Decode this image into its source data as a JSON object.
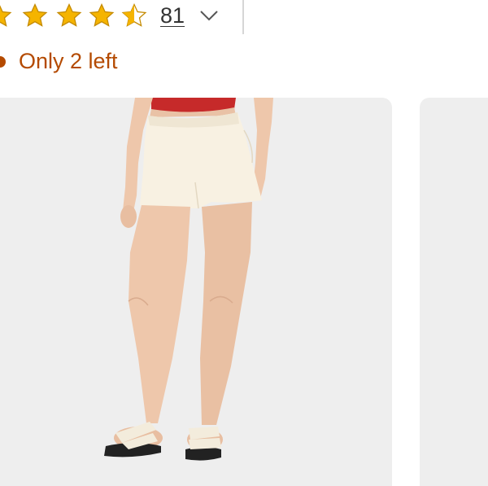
{
  "rating": {
    "stars_filled": 4.5,
    "stars_total": 5,
    "review_count": "81",
    "star_color": "#f5b400",
    "star_outline_color": "#c48a00"
  },
  "stock": {
    "label": "Only 2 left",
    "color": "#b44a00"
  },
  "icons": {
    "expand": "chevron-down-icon",
    "star": "star-icon",
    "half_star": "star-half-icon",
    "stock": "dot-icon"
  }
}
